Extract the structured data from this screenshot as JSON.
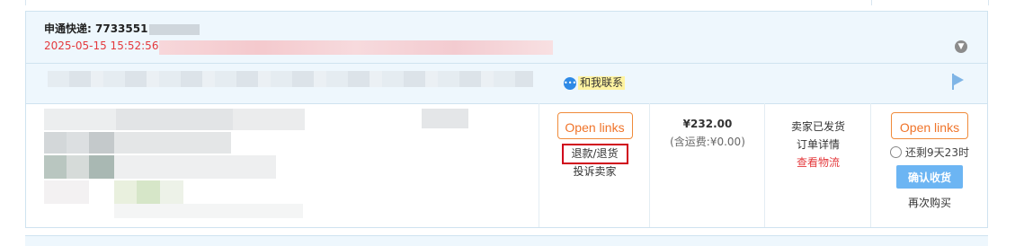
{
  "header": {
    "carrier_label": "申通快递:",
    "tracking_visible": "7733551",
    "timestamp": "2025-05-15 15:52:56"
  },
  "shop": {
    "chat_label": "和我联系"
  },
  "actions": {
    "open_links_1": "Open links",
    "refund_return": "退款/退货",
    "complain_seller": "投诉卖家",
    "open_links_2": "Open links"
  },
  "price": {
    "amount": "¥232.00",
    "shipping": "(含运费:¥0.00)"
  },
  "status": {
    "seller_shipped": "卖家已发货",
    "order_details": "订单详情",
    "view_logistics": "查看物流"
  },
  "receipt": {
    "remaining": "还剩9天23时",
    "confirm_label": "确认收货",
    "rebuy": "再次购买"
  },
  "colors": {
    "accent_red": "#e4393c",
    "link_orange": "#f08b3a",
    "confirm_blue": "#6cb5f3",
    "head_bg": "#eef7fd"
  },
  "icons": [
    "collapse-chevron-icon",
    "chat-bubble-icon",
    "flag-icon",
    "timer-icon"
  ]
}
